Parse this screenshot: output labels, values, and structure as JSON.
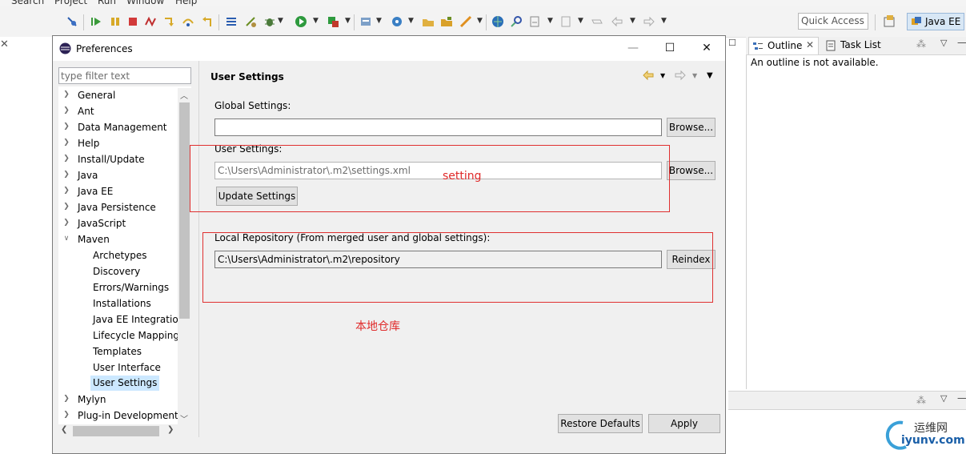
{
  "menu": {
    "items": [
      "Search",
      "Project",
      "Run",
      "Window",
      "Help"
    ]
  },
  "quick_access": {
    "placeholder": "Quick Access"
  },
  "perspective": {
    "label": "Java EE"
  },
  "outline": {
    "tabs": [
      {
        "label": "Outline"
      },
      {
        "label": "Task List"
      }
    ],
    "message": "An outline is not available."
  },
  "dialog": {
    "title": "Preferences",
    "window_buttons": {
      "minimize": "—",
      "maximize": "☐",
      "close": "✕"
    },
    "filter": {
      "placeholder": "type filter text"
    },
    "tree": [
      {
        "label": "General",
        "level": 0,
        "expander": "collapsed"
      },
      {
        "label": "Ant",
        "level": 0,
        "expander": "collapsed"
      },
      {
        "label": "Data Management",
        "level": 0,
        "expander": "collapsed"
      },
      {
        "label": "Help",
        "level": 0,
        "expander": "collapsed"
      },
      {
        "label": "Install/Update",
        "level": 0,
        "expander": "collapsed"
      },
      {
        "label": "Java",
        "level": 0,
        "expander": "collapsed"
      },
      {
        "label": "Java EE",
        "level": 0,
        "expander": "collapsed"
      },
      {
        "label": "Java Persistence",
        "level": 0,
        "expander": "collapsed"
      },
      {
        "label": "JavaScript",
        "level": 0,
        "expander": "collapsed"
      },
      {
        "label": "Maven",
        "level": 0,
        "expander": "expanded"
      },
      {
        "label": "Archetypes",
        "level": 1
      },
      {
        "label": "Discovery",
        "level": 1
      },
      {
        "label": "Errors/Warnings",
        "level": 1
      },
      {
        "label": "Installations",
        "level": 1
      },
      {
        "label": "Java EE Integration",
        "level": 1
      },
      {
        "label": "Lifecycle Mapping",
        "level": 1
      },
      {
        "label": "Templates",
        "level": 1
      },
      {
        "label": "User Interface",
        "level": 1
      },
      {
        "label": "User Settings",
        "level": 1,
        "selected": true
      },
      {
        "label": "Mylyn",
        "level": 0,
        "expander": "collapsed"
      },
      {
        "label": "Plug-in Development",
        "level": 0,
        "expander": "collapsed"
      }
    ],
    "page": {
      "title": "User Settings",
      "global_settings": {
        "label": "Global Settings:",
        "value": "",
        "browse_label": "Browse..."
      },
      "user_settings": {
        "label": "User Settings:",
        "value": "C:\\Users\\Administrator\\.m2\\settings.xml",
        "browse_label": "Browse..."
      },
      "update_settings_label": "Update Settings",
      "local_repo": {
        "label": "Local Repository (From merged user and global settings):",
        "value": "C:\\Users\\Administrator\\.m2\\repository",
        "reindex_label": "Reindex"
      },
      "restore_defaults_label": "Restore Defaults",
      "apply_label": "Apply"
    }
  },
  "annotations": {
    "setting_label": "setting",
    "local_repo_label": "本地仓库",
    "color": "#e03030"
  },
  "watermark": {
    "cn": "运维网",
    "en": "iyunv.com"
  }
}
